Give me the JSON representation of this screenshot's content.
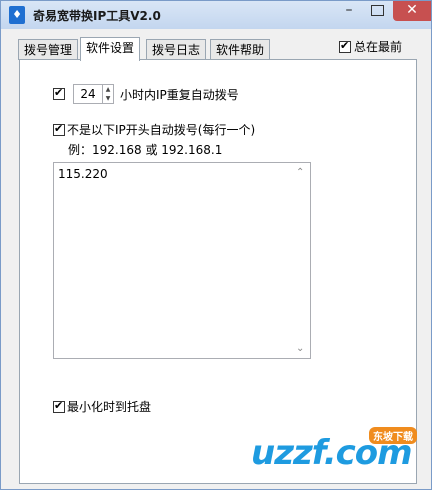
{
  "window": {
    "title": "奇易宽带换IP工具V2.0",
    "controls": {
      "minimize": "–",
      "close": "✕"
    }
  },
  "tabs": [
    {
      "label": "拨号管理"
    },
    {
      "label": "软件设置"
    },
    {
      "label": "拨号日志"
    },
    {
      "label": "软件帮助"
    }
  ],
  "always_on_top": {
    "label": "总在最前",
    "checked": true
  },
  "settings": {
    "redial": {
      "checked": true,
      "hours": "24",
      "label": "小时内IP重复自动拨号"
    },
    "prefix": {
      "checked": true,
      "label": "不是以下IP开头自动拨号(每行一个)",
      "example": "例：192.168 或 192.168.1"
    },
    "prefix_list": "115.220",
    "minimize_tray": {
      "checked": true,
      "label": "最小化时到托盘"
    }
  },
  "watermark": {
    "text": "uzzf.com",
    "tag": "东坡下载"
  }
}
